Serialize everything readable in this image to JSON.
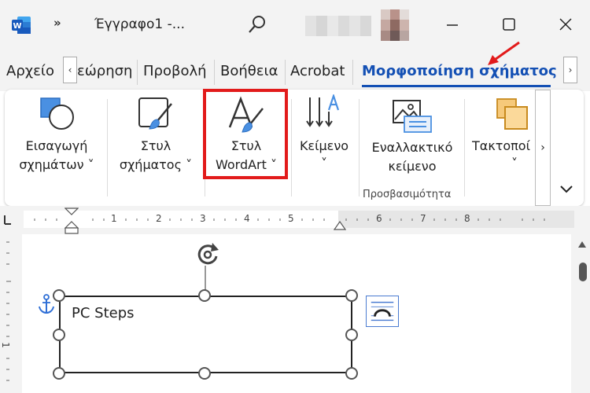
{
  "titlebar": {
    "app_icon": "word-icon",
    "app_letter": "W",
    "more_label": "»",
    "doc_title": "Έγγραφο1  -...",
    "search_icon": "search-icon"
  },
  "tabs": {
    "items": [
      {
        "label": "Αρχείο"
      },
      {
        "label": "εώρηση"
      },
      {
        "label": "Προβολή"
      },
      {
        "label": "Βοήθεια"
      },
      {
        "label": "Acrobat"
      },
      {
        "label": "Μορφοποίηση σχήματος"
      }
    ],
    "scroll_left": "‹",
    "scroll_right": "›"
  },
  "ribbon": {
    "insert_shapes": {
      "line1": "Εισαγωγή",
      "line2": "σχημάτων ˅"
    },
    "shape_style": {
      "line1": "Στυλ",
      "line2": "σχήματος ˅"
    },
    "wordart_style": {
      "line1": "Στυλ",
      "line2": "WordArt ˅"
    },
    "text": {
      "line1": "Κείμενο",
      "line2": "˅"
    },
    "alt_text": {
      "line1": "Εναλλακτικό",
      "line2": "κείμενο"
    },
    "accessibility_group": "Προσβασιμότητα",
    "arrange": {
      "line1": "Τακτοποί",
      "line2": "˅"
    },
    "scroll_right": "›",
    "expand": "˅"
  },
  "ruler": {
    "marks": [
      "1",
      "2",
      "3",
      "4",
      "5",
      "6",
      "7",
      "8"
    ],
    "left_marker": "L"
  },
  "vruler": {
    "mark": "1"
  },
  "document": {
    "shape_text": "PC Steps"
  },
  "colors": {
    "accent_tab": "#1450b4",
    "highlight": "#e21b1b",
    "word_blue": "#185abd",
    "chrome": "#f3f3f3"
  }
}
